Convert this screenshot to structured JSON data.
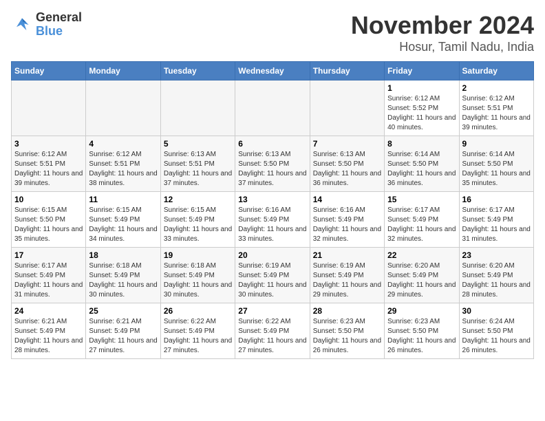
{
  "logo": {
    "line1": "General",
    "line2": "Blue"
  },
  "title": "November 2024",
  "location": "Hosur, Tamil Nadu, India",
  "days_of_week": [
    "Sunday",
    "Monday",
    "Tuesday",
    "Wednesday",
    "Thursday",
    "Friday",
    "Saturday"
  ],
  "weeks": [
    [
      {
        "day": "",
        "empty": true
      },
      {
        "day": "",
        "empty": true
      },
      {
        "day": "",
        "empty": true
      },
      {
        "day": "",
        "empty": true
      },
      {
        "day": "",
        "empty": true
      },
      {
        "day": "1",
        "sunrise": "6:12 AM",
        "sunset": "5:52 PM",
        "daylight": "11 hours and 40 minutes."
      },
      {
        "day": "2",
        "sunrise": "6:12 AM",
        "sunset": "5:51 PM",
        "daylight": "11 hours and 39 minutes."
      }
    ],
    [
      {
        "day": "3",
        "sunrise": "6:12 AM",
        "sunset": "5:51 PM",
        "daylight": "11 hours and 39 minutes."
      },
      {
        "day": "4",
        "sunrise": "6:12 AM",
        "sunset": "5:51 PM",
        "daylight": "11 hours and 38 minutes."
      },
      {
        "day": "5",
        "sunrise": "6:13 AM",
        "sunset": "5:51 PM",
        "daylight": "11 hours and 37 minutes."
      },
      {
        "day": "6",
        "sunrise": "6:13 AM",
        "sunset": "5:50 PM",
        "daylight": "11 hours and 37 minutes."
      },
      {
        "day": "7",
        "sunrise": "6:13 AM",
        "sunset": "5:50 PM",
        "daylight": "11 hours and 36 minutes."
      },
      {
        "day": "8",
        "sunrise": "6:14 AM",
        "sunset": "5:50 PM",
        "daylight": "11 hours and 36 minutes."
      },
      {
        "day": "9",
        "sunrise": "6:14 AM",
        "sunset": "5:50 PM",
        "daylight": "11 hours and 35 minutes."
      }
    ],
    [
      {
        "day": "10",
        "sunrise": "6:15 AM",
        "sunset": "5:50 PM",
        "daylight": "11 hours and 35 minutes."
      },
      {
        "day": "11",
        "sunrise": "6:15 AM",
        "sunset": "5:49 PM",
        "daylight": "11 hours and 34 minutes."
      },
      {
        "day": "12",
        "sunrise": "6:15 AM",
        "sunset": "5:49 PM",
        "daylight": "11 hours and 33 minutes."
      },
      {
        "day": "13",
        "sunrise": "6:16 AM",
        "sunset": "5:49 PM",
        "daylight": "11 hours and 33 minutes."
      },
      {
        "day": "14",
        "sunrise": "6:16 AM",
        "sunset": "5:49 PM",
        "daylight": "11 hours and 32 minutes."
      },
      {
        "day": "15",
        "sunrise": "6:17 AM",
        "sunset": "5:49 PM",
        "daylight": "11 hours and 32 minutes."
      },
      {
        "day": "16",
        "sunrise": "6:17 AM",
        "sunset": "5:49 PM",
        "daylight": "11 hours and 31 minutes."
      }
    ],
    [
      {
        "day": "17",
        "sunrise": "6:17 AM",
        "sunset": "5:49 PM",
        "daylight": "11 hours and 31 minutes."
      },
      {
        "day": "18",
        "sunrise": "6:18 AM",
        "sunset": "5:49 PM",
        "daylight": "11 hours and 30 minutes."
      },
      {
        "day": "19",
        "sunrise": "6:18 AM",
        "sunset": "5:49 PM",
        "daylight": "11 hours and 30 minutes."
      },
      {
        "day": "20",
        "sunrise": "6:19 AM",
        "sunset": "5:49 PM",
        "daylight": "11 hours and 30 minutes."
      },
      {
        "day": "21",
        "sunrise": "6:19 AM",
        "sunset": "5:49 PM",
        "daylight": "11 hours and 29 minutes."
      },
      {
        "day": "22",
        "sunrise": "6:20 AM",
        "sunset": "5:49 PM",
        "daylight": "11 hours and 29 minutes."
      },
      {
        "day": "23",
        "sunrise": "6:20 AM",
        "sunset": "5:49 PM",
        "daylight": "11 hours and 28 minutes."
      }
    ],
    [
      {
        "day": "24",
        "sunrise": "6:21 AM",
        "sunset": "5:49 PM",
        "daylight": "11 hours and 28 minutes."
      },
      {
        "day": "25",
        "sunrise": "6:21 AM",
        "sunset": "5:49 PM",
        "daylight": "11 hours and 27 minutes."
      },
      {
        "day": "26",
        "sunrise": "6:22 AM",
        "sunset": "5:49 PM",
        "daylight": "11 hours and 27 minutes."
      },
      {
        "day": "27",
        "sunrise": "6:22 AM",
        "sunset": "5:49 PM",
        "daylight": "11 hours and 27 minutes."
      },
      {
        "day": "28",
        "sunrise": "6:23 AM",
        "sunset": "5:50 PM",
        "daylight": "11 hours and 26 minutes."
      },
      {
        "day": "29",
        "sunrise": "6:23 AM",
        "sunset": "5:50 PM",
        "daylight": "11 hours and 26 minutes."
      },
      {
        "day": "30",
        "sunrise": "6:24 AM",
        "sunset": "5:50 PM",
        "daylight": "11 hours and 26 minutes."
      }
    ]
  ]
}
